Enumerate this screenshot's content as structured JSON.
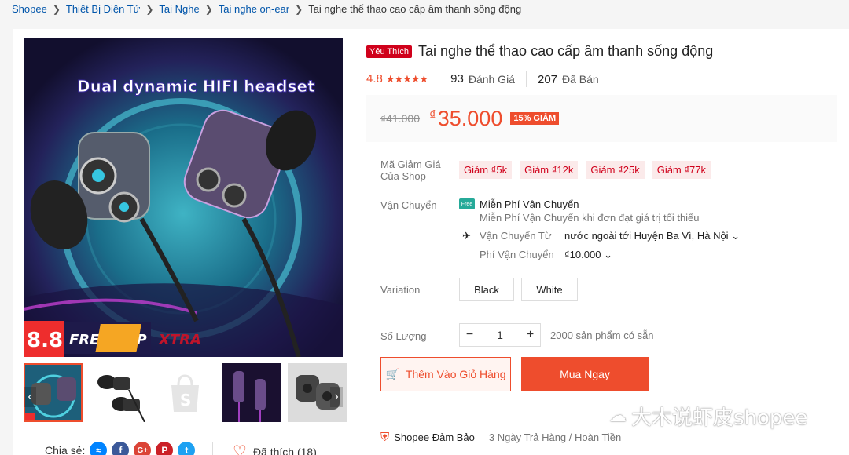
{
  "breadcrumb": [
    "Shopee",
    "Thiết Bị Điện Tử",
    "Tai Nghe",
    "Tai nghe on-ear",
    "Tai nghe thể thao cao cấp âm thanh sống động"
  ],
  "product": {
    "badge": "Yêu Thích",
    "title": "Tai nghe thể thao cao cấp âm thanh sống động",
    "rating": "4.8",
    "stars": "★★★★★",
    "review_count": "93",
    "review_label": "Đánh Giá",
    "sold_count": "207",
    "sold_label": "Đã Bán",
    "old_price": "₫41.000",
    "currency": "₫",
    "new_price": "35.000",
    "discount": "15% GIẢM"
  },
  "image": {
    "banner_text": "Dual dynamic HIFI headset",
    "promo_number": "8.8",
    "promo_text": "FREESHIP",
    "promo_xtra": "XTRA"
  },
  "voucher": {
    "label": "Mã Giảm Giá Của Shop",
    "items": [
      "Giảm ₫5k",
      "Giảm ₫12k",
      "Giảm ₫25k",
      "Giảm ₫77k"
    ]
  },
  "shipping": {
    "label": "Vận Chuyển",
    "free_icon": "Free",
    "free_title": "Miễn Phí Vận Chuyển",
    "free_desc": "Miễn Phí Vận Chuyển khi đơn đạt giá trị tối thiểu",
    "from_label": "Vận Chuyển Từ",
    "from_value": "nước ngoài tới Huyện Ba Vì, Hà Nội",
    "fee_label": "Phí Vận Chuyển",
    "fee_value": "₫10.000"
  },
  "variation": {
    "label": "Variation",
    "options": [
      "Black",
      "White"
    ]
  },
  "quantity": {
    "label": "Số Lượng",
    "minus": "−",
    "plus": "+",
    "value": "1",
    "stock": "2000 sản phẩm có sẵn"
  },
  "actions": {
    "add_to_cart": "Thêm Vào Giỏ Hàng",
    "buy_now": "Mua Ngay"
  },
  "share": {
    "label": "Chia sẻ:",
    "like_label": "Đã thích (18)"
  },
  "guarantee": {
    "title": "Shopee Đảm Bảo",
    "sub": "3 Ngày Trả Hàng / Hoàn Tiền"
  },
  "watermark": "大木说虾皮shopee",
  "colors": {
    "accent": "#ee4d2d",
    "brand_red": "#d0011b"
  }
}
